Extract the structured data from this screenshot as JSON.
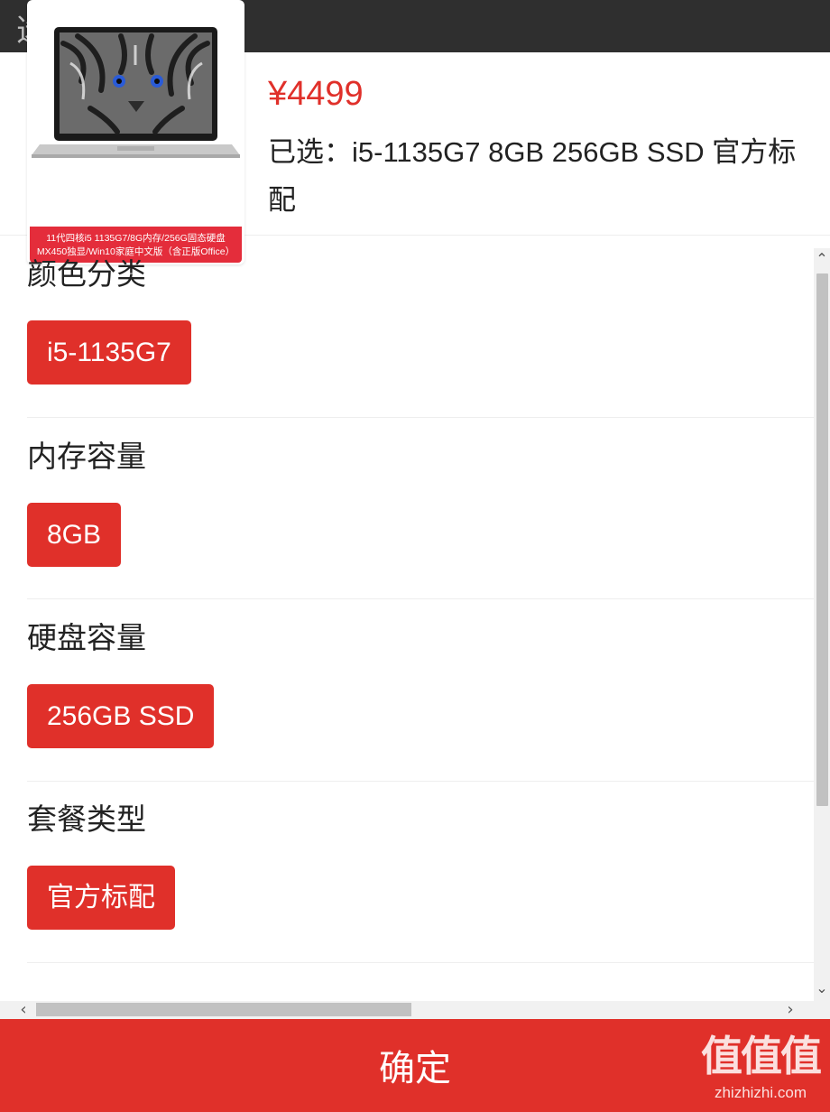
{
  "header": {
    "top_glyph": "选"
  },
  "product": {
    "price": "¥4499",
    "selected_label": "已选：i5-1135G7 8GB 256GB SSD 官方标配",
    "image_banner_line1": "11代四核i5 1135G7/8G内存/256G固态硬盘",
    "image_banner_line2": "MX450独显/Win10家庭中文版（含正版Office）"
  },
  "groups": [
    {
      "title": "颜色分类",
      "option": "i5-1135G7"
    },
    {
      "title": "内存容量",
      "option": "8GB"
    },
    {
      "title": "硬盘容量",
      "option": "256GB SSD"
    },
    {
      "title": "套餐类型",
      "option": "官方标配"
    }
  ],
  "footer": {
    "confirm_label": "确定"
  },
  "watermark": {
    "glyph": "值值值",
    "url": "zhizhizhi.com"
  },
  "colors": {
    "accent": "#e0302a",
    "banner": "#e42d3b",
    "topbar": "#2f2f2f"
  },
  "icons": {
    "scroll_up": "▲-icon",
    "scroll_down": "▼-icon",
    "scroll_left": "◀-icon",
    "scroll_right": "▶-icon"
  }
}
